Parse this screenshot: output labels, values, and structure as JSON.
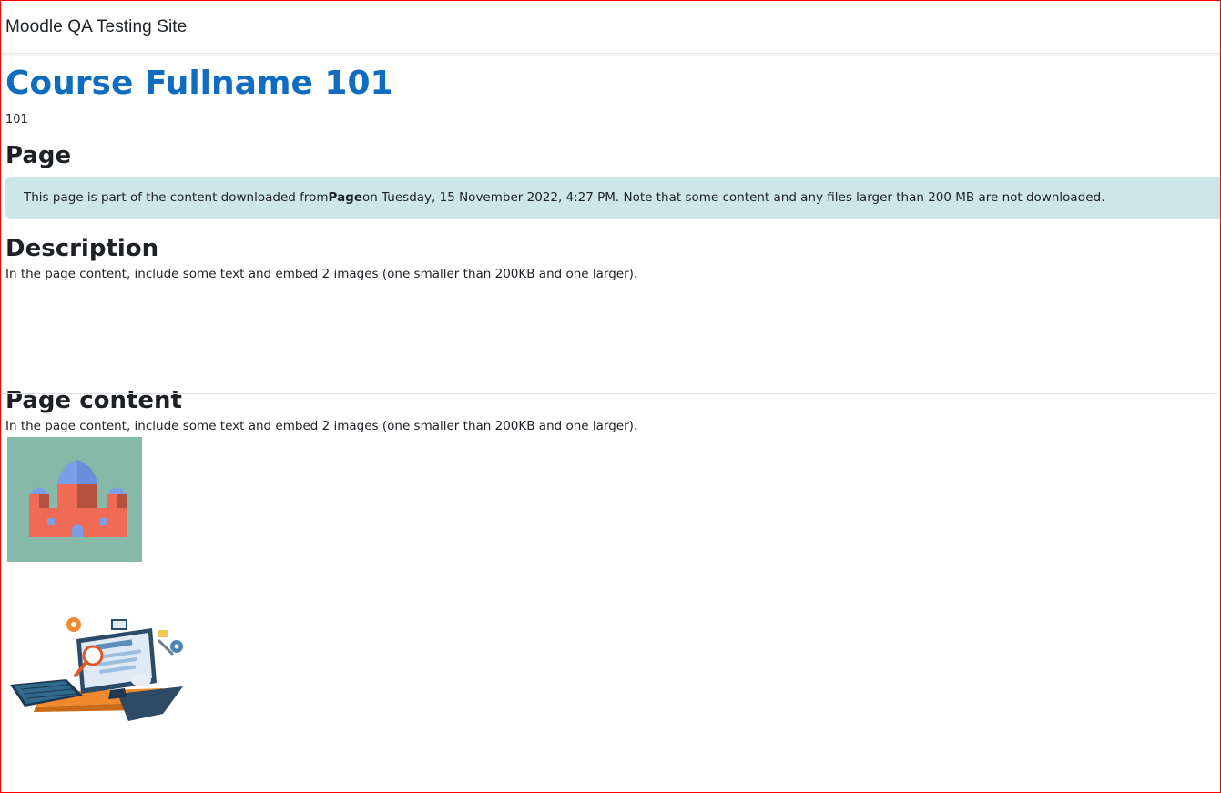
{
  "header": {
    "site_name": "Moodle QA Testing Site"
  },
  "course": {
    "fullname": "Course Fullname 101",
    "shortname": "101"
  },
  "activity": {
    "title": "Page",
    "notice": {
      "prefix": "This page is part of the content downloaded from ",
      "link_text": "Page",
      "suffix": " on Tuesday, 15 November 2022, 4:27 PM. Note that some content and any files larger than 200 MB are not downloaded."
    },
    "description_heading": "Description",
    "description_text": "In the page content, include some text and embed 2 images (one smaller than 200KB and one larger).",
    "content_heading": "Page content",
    "content_text": "In the page content, include some text and embed 2 images (one smaller than 200KB and one larger)."
  },
  "colors": {
    "accent": "#0f6cbf",
    "notice_bg": "#cce6ea",
    "frame_border": "#ff0000"
  },
  "images": [
    {
      "name": "mosque-illustration"
    },
    {
      "name": "computer-workstation-illustration"
    }
  ]
}
